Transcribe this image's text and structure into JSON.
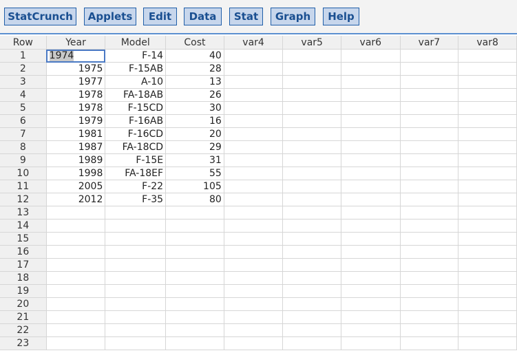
{
  "menu": [
    {
      "label": "StatCrunch",
      "name": "menu-statcrunch-button"
    },
    {
      "label": "Applets",
      "name": "menu-applets-button"
    },
    {
      "label": "Edit",
      "name": "menu-edit-button"
    },
    {
      "label": "Data",
      "name": "menu-data-button"
    },
    {
      "label": "Stat",
      "name": "menu-stat-button"
    },
    {
      "label": "Graph",
      "name": "menu-graph-button"
    },
    {
      "label": "Help",
      "name": "menu-help-button"
    }
  ],
  "grid": {
    "headers": [
      "Row",
      "Year",
      "Model",
      "Cost",
      "var4",
      "var5",
      "var6",
      "var7",
      "var8"
    ],
    "selected_cell": {
      "row": 1,
      "column": "Year"
    },
    "rows": [
      {
        "row": "1",
        "year": "1974",
        "model": "F-14",
        "cost": "40"
      },
      {
        "row": "2",
        "year": "1975",
        "model": "F-15AB",
        "cost": "28"
      },
      {
        "row": "3",
        "year": "1977",
        "model": "A-10",
        "cost": "13"
      },
      {
        "row": "4",
        "year": "1978",
        "model": "FA-18AB",
        "cost": "26"
      },
      {
        "row": "5",
        "year": "1978",
        "model": "F-15CD",
        "cost": "30"
      },
      {
        "row": "6",
        "year": "1979",
        "model": "F-16AB",
        "cost": "16"
      },
      {
        "row": "7",
        "year": "1981",
        "model": "F-16CD",
        "cost": "20"
      },
      {
        "row": "8",
        "year": "1987",
        "model": "FA-18CD",
        "cost": "29"
      },
      {
        "row": "9",
        "year": "1989",
        "model": "F-15E",
        "cost": "31"
      },
      {
        "row": "10",
        "year": "1998",
        "model": "FA-18EF",
        "cost": "55"
      },
      {
        "row": "11",
        "year": "2005",
        "model": "F-22",
        "cost": "105"
      },
      {
        "row": "12",
        "year": "2012",
        "model": "F-35",
        "cost": "80"
      },
      {
        "row": "13",
        "year": "",
        "model": "",
        "cost": ""
      },
      {
        "row": "14",
        "year": "",
        "model": "",
        "cost": ""
      },
      {
        "row": "15",
        "year": "",
        "model": "",
        "cost": ""
      },
      {
        "row": "16",
        "year": "",
        "model": "",
        "cost": ""
      },
      {
        "row": "17",
        "year": "",
        "model": "",
        "cost": ""
      },
      {
        "row": "18",
        "year": "",
        "model": "",
        "cost": ""
      },
      {
        "row": "19",
        "year": "",
        "model": "",
        "cost": ""
      },
      {
        "row": "20",
        "year": "",
        "model": "",
        "cost": ""
      },
      {
        "row": "21",
        "year": "",
        "model": "",
        "cost": ""
      },
      {
        "row": "22",
        "year": "",
        "model": "",
        "cost": ""
      },
      {
        "row": "23",
        "year": "",
        "model": "",
        "cost": ""
      }
    ]
  },
  "colors": {
    "button_fill": "#c7d6ec",
    "button_border": "#1f5ea8",
    "button_text": "#1a4f91",
    "toolbar_rule": "#5b8fd0",
    "selection_outline": "#4a79c4",
    "header_fill": "#f0f0f0",
    "grid_line": "#d6d6d6"
  }
}
